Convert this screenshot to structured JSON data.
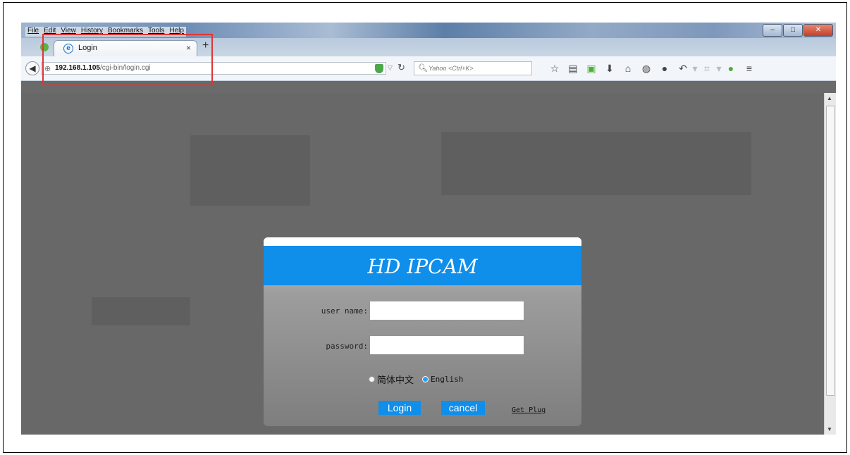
{
  "browser": {
    "menu": [
      "File",
      "Edit",
      "View",
      "History",
      "Bookmarks",
      "Tools",
      "Help"
    ],
    "window_controls": {
      "minimize": "–",
      "maximize": "□",
      "close": "✕"
    },
    "tab": {
      "title": "Login",
      "close": "×",
      "new_tab": "+"
    },
    "url": {
      "host": "192.168.1.105",
      "path": "/cgi-bin/login.cgi"
    },
    "search_placeholder": "Yahoo <Ctrl+K>",
    "toolbar_icons": [
      "star-icon",
      "reading-list-icon",
      "addon-icon",
      "download-icon",
      "home-icon",
      "sync-icon",
      "chat-icon",
      "undo-icon",
      "dropdown-icon",
      "crop-icon",
      "dropdown-icon",
      "speech-icon",
      "menu-icon"
    ],
    "accent_highlight": "#e03535"
  },
  "login": {
    "title": "HD IPCAM",
    "username_label": "user name:",
    "username_value": "",
    "password_label": "password:",
    "password_value": "",
    "lang_cn": "简体中文",
    "lang_en": "English",
    "selected_lang": "English",
    "login_button": "Login",
    "cancel_button": "cancel",
    "plugin_link": "Get Plug"
  },
  "colors": {
    "header_blue": "#0f8eea",
    "page_bg": "#686868"
  }
}
